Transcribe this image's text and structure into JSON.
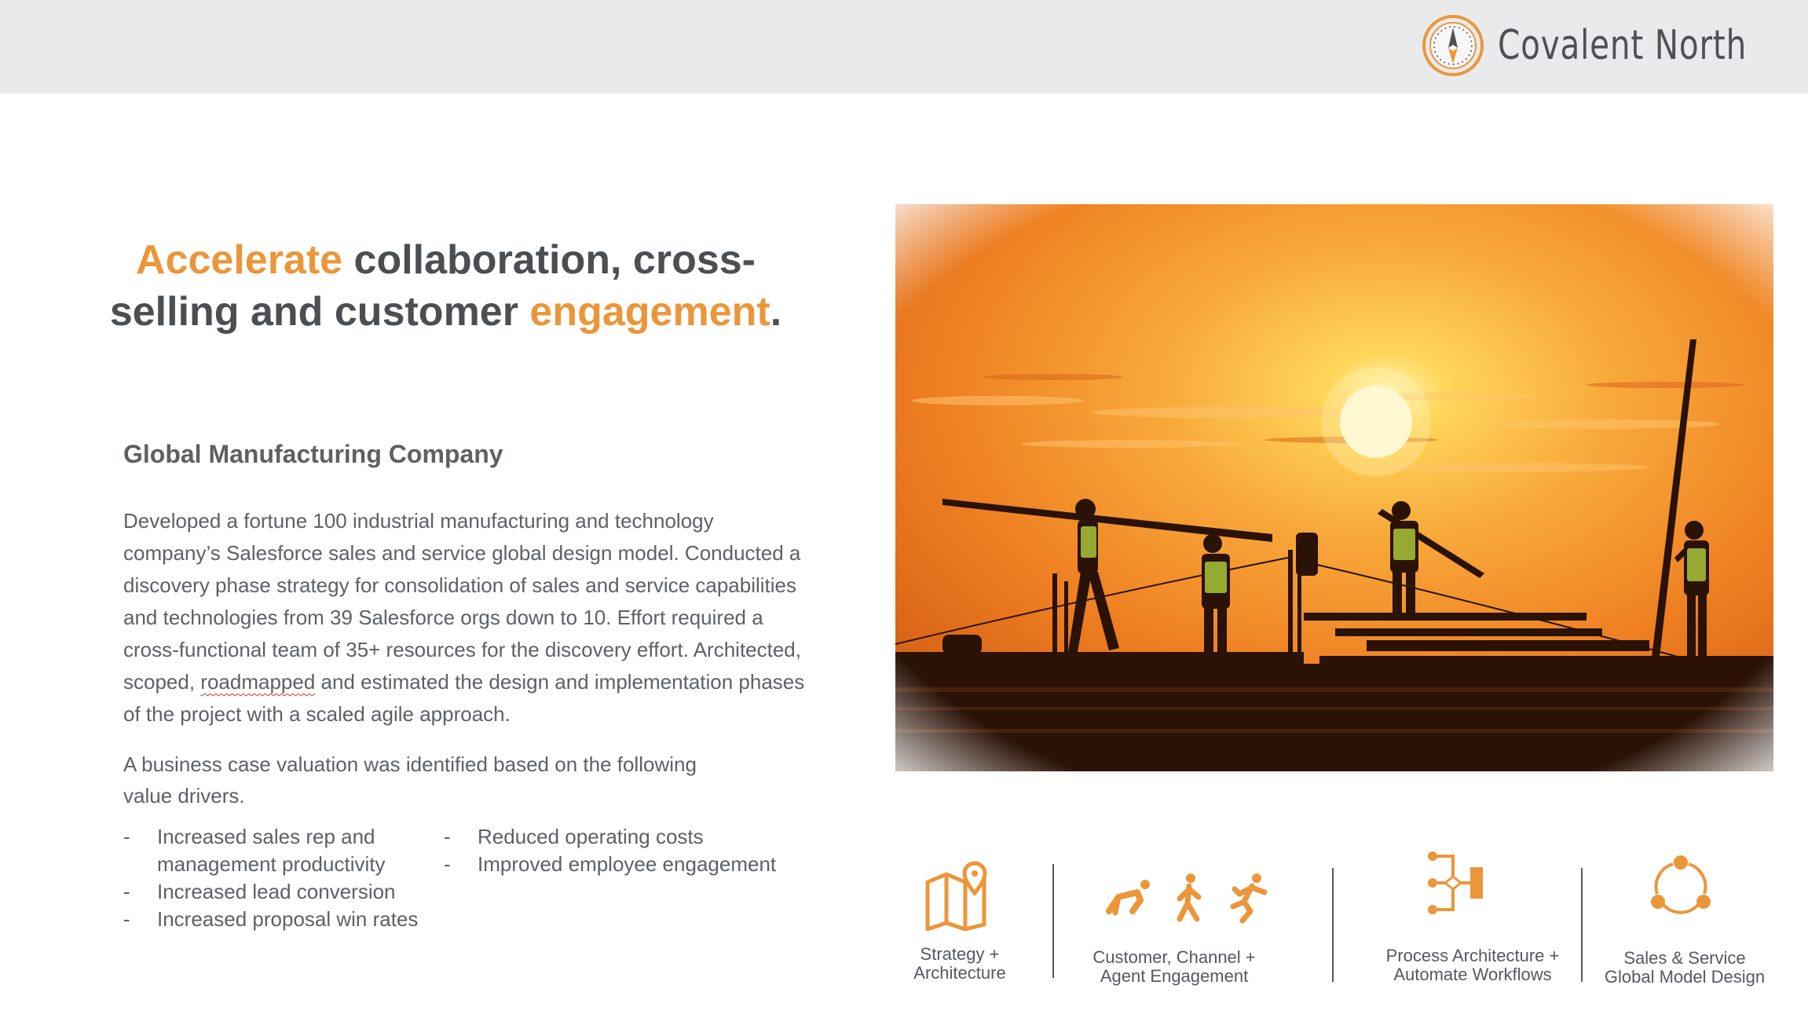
{
  "brand": {
    "name": "Covalent North",
    "logo_icon": "compass-icon",
    "accent_color": "#eb963a"
  },
  "headline": {
    "accent_1": "Accelerate",
    "text_1": " collaboration, cross-",
    "text_2": "selling and customer ",
    "accent_2": "engagement",
    "end": "."
  },
  "company": "Global Manufacturing Company",
  "description": {
    "before": "Developed a fortune 100 industrial manufacturing and technology company’s Salesforce sales and service global design model. Conducted a discovery phase strategy for consolidation of sales and service capabilities and technologies from 39 Salesforce orgs down to 10. Effort required a cross-functional team of 35+ resources for the discovery effort. Architected, scoped, ",
    "flagged_word": "roadmapped",
    "after": " and estimated the design and implementation phases of the project with a scaled agile approach."
  },
  "value_intro": "A business case valuation was identified based on the following value drivers.",
  "drivers_left": [
    "Increased sales rep and management productivity",
    "Increased lead conversion",
    "Increased proposal win rates"
  ],
  "drivers_right": [
    "Reduced operating costs",
    "Improved employee engagement"
  ],
  "capabilities": [
    {
      "icon": "map-pin-icon",
      "line1": "Strategy +",
      "line2": "Architecture"
    },
    {
      "icon": "crawl-walk-run-icon",
      "line1": "Customer, Channel +",
      "line2": "Agent Engagement"
    },
    {
      "icon": "workflow-icon",
      "line1": "Process Architecture +",
      "line2": "Automate Workflows"
    },
    {
      "icon": "cycle-icon",
      "line1": "Sales & Service",
      "line2": "Global Model Design"
    }
  ],
  "photo": {
    "subject": "construction workers silhouetted at sunset"
  }
}
